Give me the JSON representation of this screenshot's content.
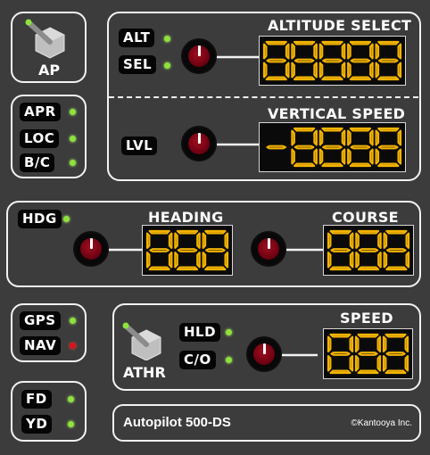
{
  "ap": {
    "label": "AP"
  },
  "mode_buttons": {
    "apr": "APR",
    "loc": "LOC",
    "bc": "B/C"
  },
  "altitude": {
    "alt": "ALT",
    "sel": "SEL",
    "title": "ALTITUDE SELECT",
    "display": "88888"
  },
  "vertical_speed": {
    "lvl": "LVL",
    "title": "VERTICAL SPEED",
    "display": "-8888"
  },
  "heading": {
    "hdg": "HDG",
    "title": "HEADING",
    "display": "888"
  },
  "course": {
    "title": "COURSE",
    "display": "888"
  },
  "nav_source": {
    "gps": "GPS",
    "nav": "NAV"
  },
  "speed": {
    "athr": "ATHR",
    "hld": "HLD",
    "co": "C/O",
    "title": "SPEED",
    "display": "888"
  },
  "fd_yd": {
    "fd": "FD",
    "yd": "YD"
  },
  "footer": {
    "model": "Autopilot 500-DS",
    "copyright": "©Kantooya Inc."
  },
  "colors": {
    "segment": "#f2b300",
    "led_on": "#8ee23c",
    "led_alert": "#d6141a",
    "knob": "#7a0012"
  }
}
